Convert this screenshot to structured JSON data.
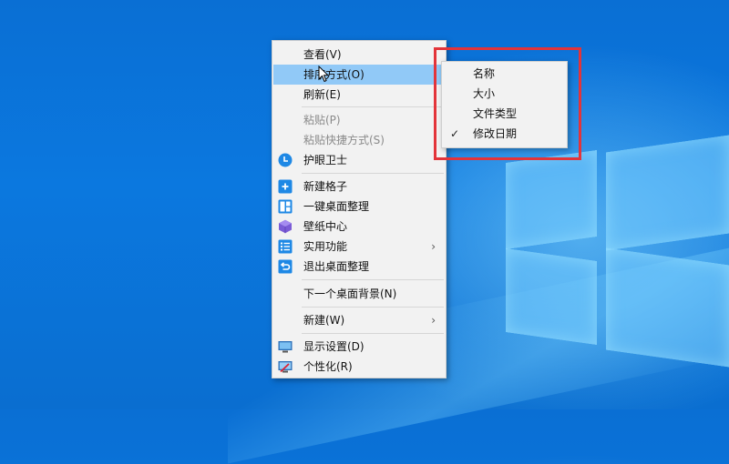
{
  "context_menu": {
    "items": [
      {
        "label": "查看(V)",
        "state": "normal"
      },
      {
        "label": "排序方式(O)",
        "state": "active",
        "has_submenu": true
      },
      {
        "label": "刷新(E)",
        "state": "normal"
      },
      {
        "label": "粘贴(P)",
        "state": "disabled"
      },
      {
        "label": "粘贴快捷方式(S)",
        "state": "disabled"
      },
      {
        "label": "护眼卫士",
        "state": "normal",
        "icon": "clock-icon"
      },
      {
        "label": "新建格子",
        "state": "normal",
        "icon": "plus-square-icon"
      },
      {
        "label": "一键桌面整理",
        "state": "normal",
        "icon": "layout-icon"
      },
      {
        "label": "壁纸中心",
        "state": "normal",
        "icon": "cube-icon"
      },
      {
        "label": "实用功能",
        "state": "normal",
        "icon": "list-icon",
        "has_submenu": true
      },
      {
        "label": "退出桌面整理",
        "state": "normal",
        "icon": "undo-icon"
      },
      {
        "label": "下一个桌面背景(N)",
        "state": "normal"
      },
      {
        "label": "新建(W)",
        "state": "normal",
        "has_submenu": true
      },
      {
        "label": "显示设置(D)",
        "state": "normal",
        "icon": "monitor-icon"
      },
      {
        "label": "个性化(R)",
        "state": "normal",
        "icon": "personalize-icon"
      }
    ],
    "submenu_arrow": "›"
  },
  "sort_submenu": {
    "items": [
      {
        "label": "名称",
        "checked": false
      },
      {
        "label": "大小",
        "checked": false
      },
      {
        "label": "文件类型",
        "checked": false
      },
      {
        "label": "修改日期",
        "checked": true
      }
    ],
    "check_glyph": "✓"
  },
  "colors": {
    "desktop_blue": "#0b78df",
    "menu_bg": "#f2f2f2",
    "menu_active": "#91c9f7",
    "annotation_red": "#e3343a",
    "icon_blue": "#1e88e5"
  }
}
